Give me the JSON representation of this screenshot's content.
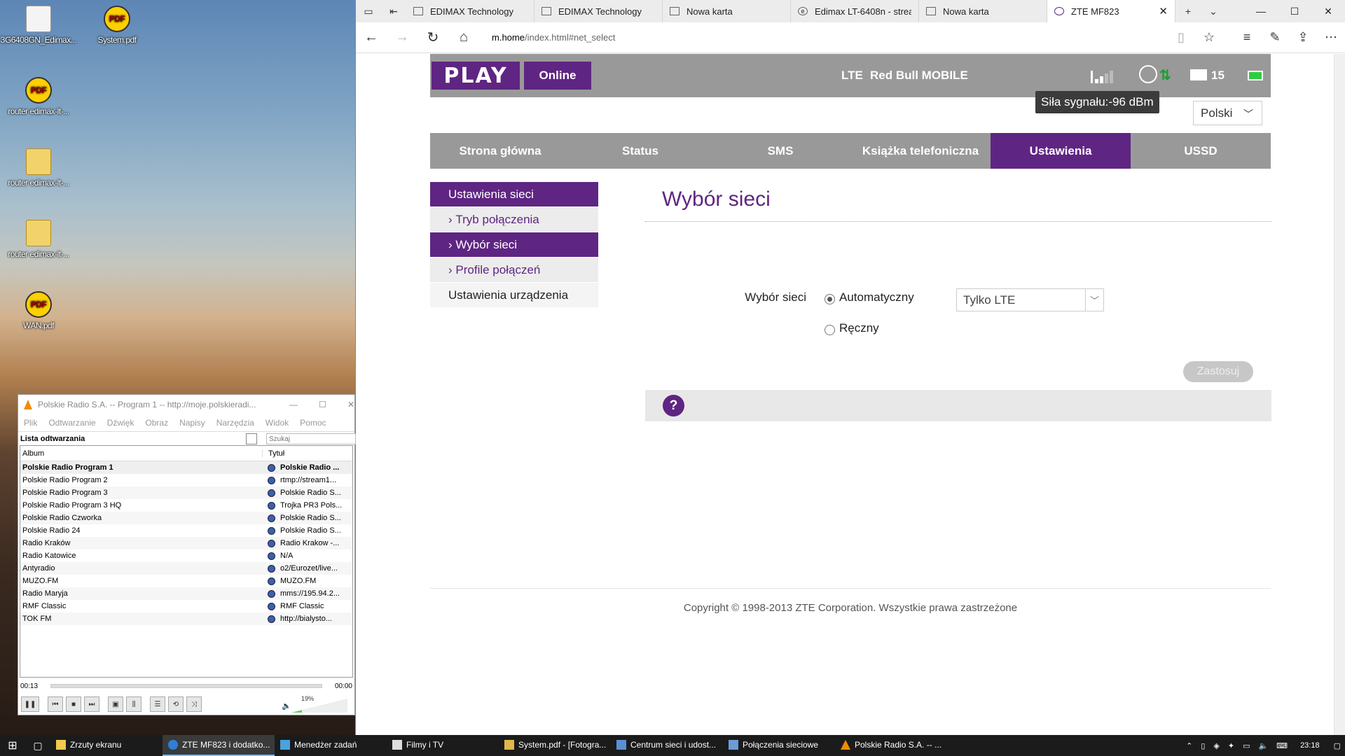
{
  "desktop": {
    "icons": [
      {
        "label": "3G6408GN_Edimax...",
        "type": "file"
      },
      {
        "label": "System.pdf",
        "type": "pdf"
      },
      {
        "label": "router edimax-lt-...",
        "type": "pdf"
      },
      {
        "label": "router edimax-lt-...",
        "type": "zip"
      },
      {
        "label": "router edimax-lt-...",
        "type": "zip"
      },
      {
        "label": "WAN.pdf",
        "type": "pdf"
      }
    ]
  },
  "browser": {
    "tabs": [
      {
        "label": "EDIMAX Technology"
      },
      {
        "label": "EDIMAX Technology"
      },
      {
        "label": "Nowa karta"
      },
      {
        "label": "Edimax LT-6408n - strear"
      },
      {
        "label": "Nowa karta"
      },
      {
        "label": "ZTE MF823"
      }
    ],
    "url_host": "m.home",
    "url_path": "/index.html#net_select"
  },
  "router": {
    "logo": "PLAY",
    "online": "Online",
    "network_type": "LTE",
    "operator": "Red Bull MOBILE",
    "signal_level": 0.4,
    "message_count": "15",
    "tooltip": "Siła sygnału:-96 dBm",
    "language": "Polski",
    "menu": [
      "Strona główna",
      "Status",
      "SMS",
      "Książka telefoniczna",
      "Ustawienia",
      "USSD"
    ],
    "active_menu": "Ustawienia",
    "side": {
      "header": "Ustawienia sieci",
      "items": [
        "Tryb połączenia",
        "Wybór sieci",
        "Profile połączeń"
      ],
      "active_item": "Wybór sieci",
      "device": "Ustawienia urządzenia"
    },
    "content": {
      "title": "Wybór sieci",
      "field_label": "Wybór sieci",
      "radio_auto": "Automatyczny",
      "radio_manual": "Ręczny",
      "selected": "Automatyczny",
      "select_value": "Tylko LTE",
      "apply": "Zastosuj",
      "help": "?"
    },
    "copyright": "Copyright © 1998-2013 ZTE Corporation. Wszystkie prawa zastrzeżone"
  },
  "vlc": {
    "title": "Polskie Radio S.A. -- Program 1 -- http://moje.polskieradi...",
    "menu": [
      "Plik",
      "Odtwarzanie",
      "Dźwięk",
      "Obraz",
      "Napisy",
      "Narzędzia",
      "Widok",
      "Pomoc"
    ],
    "playlist_title": "Lista odtwarzania",
    "search_placeholder": "Szukaj",
    "col_album": "Album",
    "col_title": "Tytuł",
    "rows": [
      {
        "album": "Polskie Radio Program 1",
        "title": "Polskie Radio ..."
      },
      {
        "album": "Polskie Radio Program 2",
        "title": "rtmp://stream1..."
      },
      {
        "album": "Polskie Radio Program 3",
        "title": "Polskie Radio S..."
      },
      {
        "album": "Polskie Radio Program 3 HQ",
        "title": "Trojka PR3 Pols..."
      },
      {
        "album": "Polskie Radio Czworka",
        "title": "Polskie Radio S..."
      },
      {
        "album": "Polskie Radio 24",
        "title": "Polskie Radio S..."
      },
      {
        "album": "Radio Kraków",
        "title": "Radio Krakow -..."
      },
      {
        "album": "Radio Katowice",
        "title": "N/A"
      },
      {
        "album": "Antyradio",
        "title": "o2/Eurozet/live..."
      },
      {
        "album": "MUZO.FM",
        "title": "MUZO.FM"
      },
      {
        "album": "Radio Maryja",
        "title": "mms://195.94.2..."
      },
      {
        "album": "RMF Classic",
        "title": "RMF Classic"
      },
      {
        "album": "TOK FM",
        "title": "http://bialysto..."
      }
    ],
    "time_elapsed": "00:13",
    "time_total": "00:00",
    "volume": "19%"
  },
  "taskbar": {
    "items": [
      {
        "label": "Zrzuty ekranu",
        "color": "#f2c94c"
      },
      {
        "label": "ZTE MF823 i dodatko...",
        "color": "#2f7fd6"
      },
      {
        "label": "Menedżer zadań",
        "color": "#4aa3df"
      },
      {
        "label": "Filmy i TV",
        "color": "#dddddd"
      },
      {
        "label": "System.pdf - [Fotogra...",
        "color": "#e0b84a"
      },
      {
        "label": "Centrum sieci i udost...",
        "color": "#5a8fd6"
      },
      {
        "label": "Połączenia sieciowe",
        "color": "#6c9bd6"
      },
      {
        "label": "Polskie Radio S.A. -- ...",
        "color": "#f08c00"
      }
    ],
    "active_index": 1,
    "time": "23:18"
  },
  "colors": {
    "brand_purple": "#5f2582",
    "header_gray": "#999999"
  }
}
